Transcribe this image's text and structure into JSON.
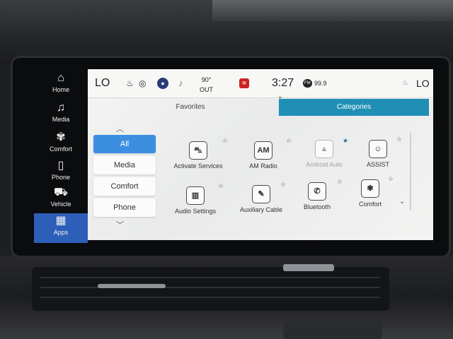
{
  "sidebar": {
    "items": [
      {
        "label": "Home",
        "icon": "home-icon",
        "glyph": "⌂"
      },
      {
        "label": "Media",
        "icon": "music-note-icon",
        "glyph": "♫"
      },
      {
        "label": "Comfort",
        "icon": "climate-icon",
        "glyph": "✾"
      },
      {
        "label": "Phone",
        "icon": "phone-icon",
        "glyph": "▯"
      },
      {
        "label": "Vehicle",
        "icon": "vehicle-icon",
        "glyph": "⛟"
      },
      {
        "label": "Apps",
        "icon": "apps-grid-icon",
        "glyph": "▦"
      }
    ],
    "active_color": "#2d5fb8"
  },
  "status": {
    "temp_left": "LO",
    "outside_temp": "90°",
    "outside_label": "OUT",
    "time": "3:27",
    "radio_band": "FM",
    "radio_freq": "99.9",
    "temp_right": "LO"
  },
  "tabs": {
    "favorites": "Favorites",
    "categories": "Categories",
    "active_color": "#1f8fb5"
  },
  "categories": [
    "All",
    "Media",
    "Comfort",
    "Phone"
  ],
  "apps": {
    "activate_services": {
      "label": "Activate Services",
      "icon": "car-connect-icon",
      "glyph": "⛍"
    },
    "am_radio": {
      "label": "AM Radio",
      "icon": "am-radio-icon",
      "glyph": "AM"
    },
    "android_auto": {
      "label": "Android Auto",
      "icon": "android-auto-icon",
      "glyph": "▲"
    },
    "assist": {
      "label": "ASSIST",
      "icon": "assist-icon",
      "glyph": "☺"
    },
    "audio_settings": {
      "label": "Audio Settings",
      "icon": "equalizer-icon",
      "glyph": "▥"
    },
    "auxiliary_cable": {
      "label": "Auxiliary Cable",
      "icon": "aux-cable-icon",
      "glyph": "✎"
    },
    "bluetooth": {
      "label": "Bluetooth",
      "icon": "bluetooth-icon",
      "glyph": "✆"
    },
    "comfort": {
      "label": "Comfort",
      "icon": "comfort-icon",
      "glyph": "✾"
    }
  }
}
